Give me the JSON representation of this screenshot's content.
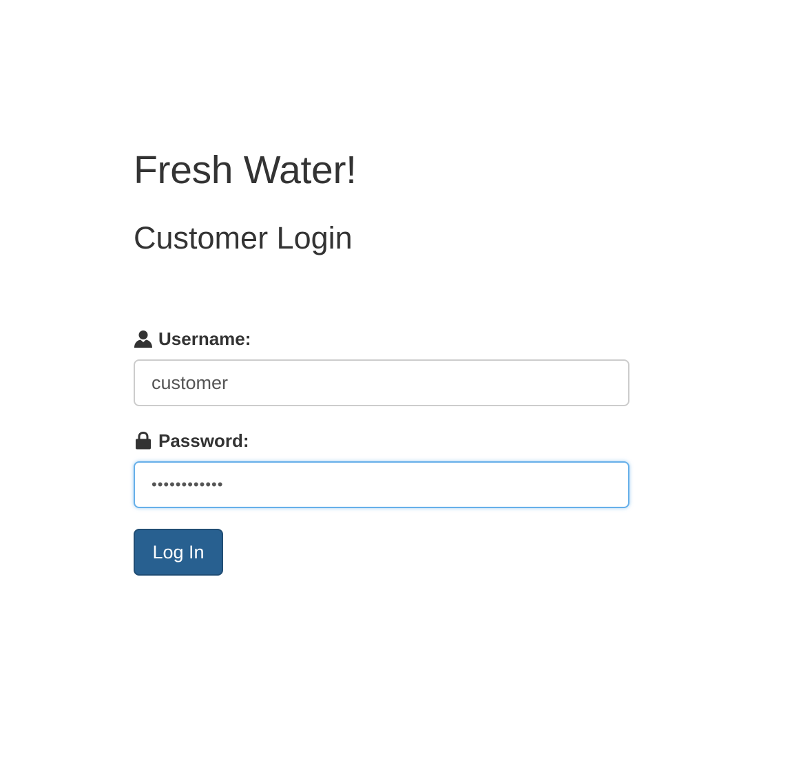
{
  "site_title": "Fresh Water!",
  "page_title": "Customer Login",
  "form": {
    "username": {
      "icon": "user-icon",
      "label": "Username:",
      "value": "customer"
    },
    "password": {
      "icon": "lock-icon",
      "label": "Password:",
      "value": "••••••••••••"
    },
    "submit_label": "Log In"
  },
  "colors": {
    "primary_button": "#286090",
    "focus_border": "#66afe9",
    "text": "#333333"
  }
}
